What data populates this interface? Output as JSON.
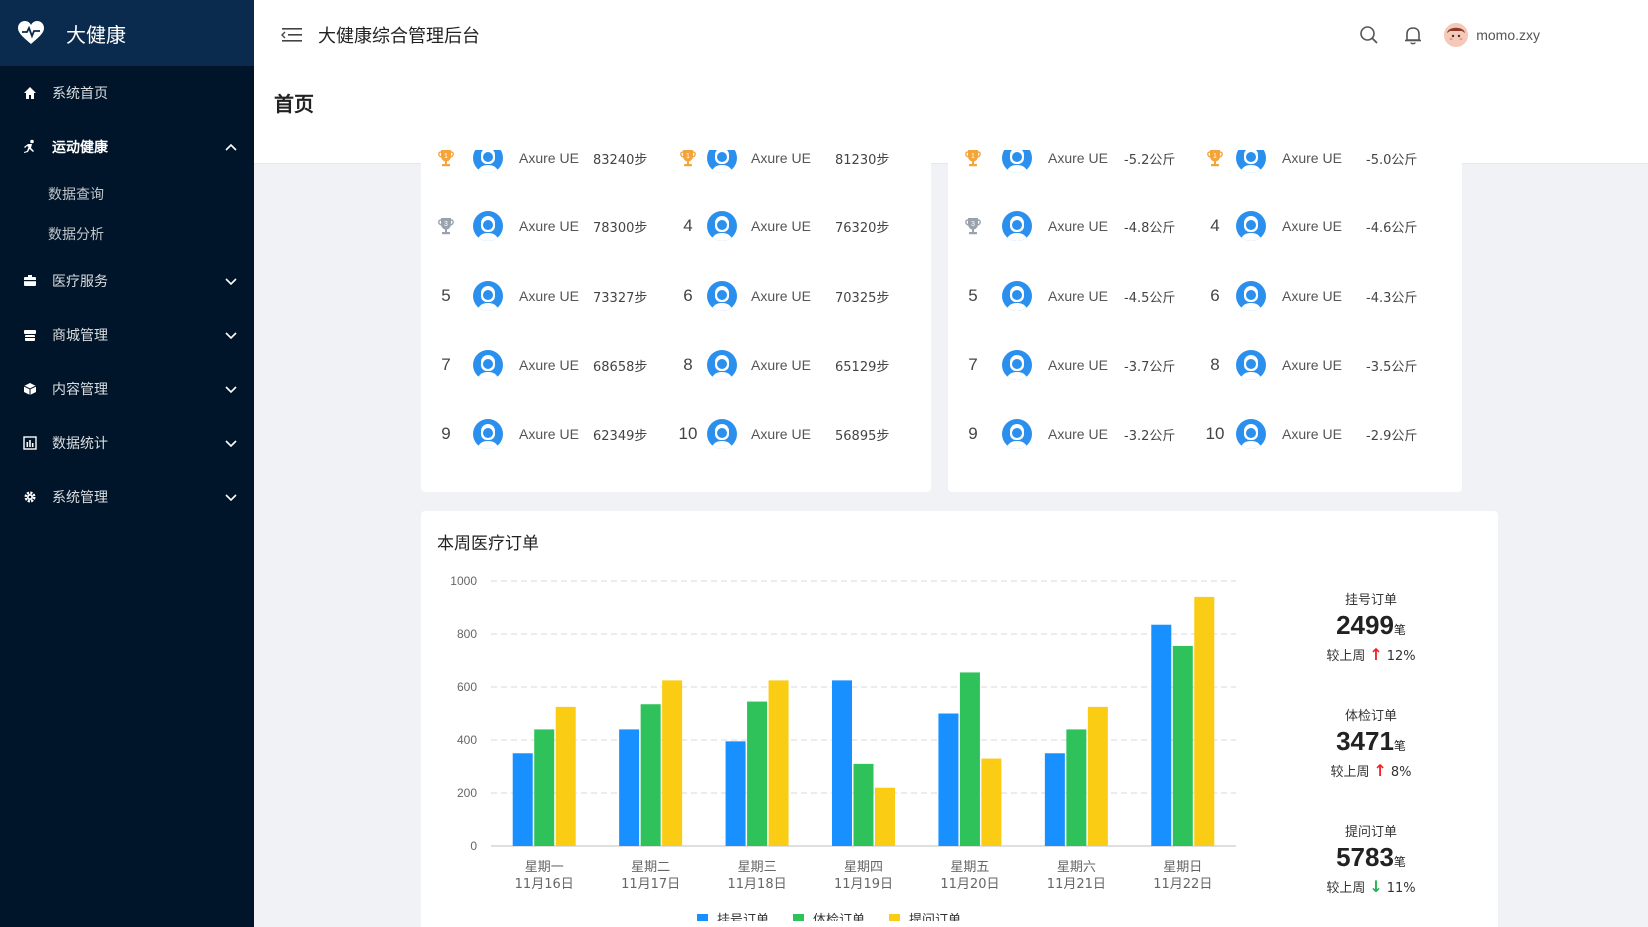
{
  "brand": {
    "name": "大健康"
  },
  "sidebar": {
    "items": [
      {
        "label": "系统首页",
        "icon": "home-icon",
        "active": false
      },
      {
        "label": "运动健康",
        "icon": "running-icon",
        "active": true,
        "expanded": true,
        "children": [
          {
            "label": "数据查询"
          },
          {
            "label": "数据分析"
          }
        ]
      },
      {
        "label": "医疗服务",
        "icon": "medical-box-icon"
      },
      {
        "label": "商城管理",
        "icon": "store-icon"
      },
      {
        "label": "内容管理",
        "icon": "cube-icon"
      },
      {
        "label": "数据统计",
        "icon": "bar-chart-icon"
      },
      {
        "label": "系统管理",
        "icon": "gear-icon"
      }
    ]
  },
  "header": {
    "title": "大健康综合管理后台",
    "username": "momo.zxy"
  },
  "page": {
    "title": "首页"
  },
  "steps_ranking": [
    [
      "",
      "Axure UE",
      "83240步",
      "",
      "Axure UE",
      "81230步"
    ],
    [
      "",
      "Axure UE",
      "78300步",
      "4",
      "Axure UE",
      "76320步"
    ],
    [
      "5",
      "Axure UE",
      "73327步",
      "6",
      "Axure UE",
      "70325步"
    ],
    [
      "7",
      "Axure UE",
      "68658步",
      "8",
      "Axure UE",
      "65129步"
    ],
    [
      "9",
      "Axure UE",
      "62349步",
      "10",
      "Axure UE",
      "56895步"
    ]
  ],
  "weight_ranking": [
    [
      "",
      "Axure UE",
      "-5.2公斤",
      "",
      "Axure UE",
      "-5.0公斤"
    ],
    [
      "",
      "Axure UE",
      "-4.8公斤",
      "4",
      "Axure UE",
      "-4.6公斤"
    ],
    [
      "5",
      "Axure UE",
      "-4.5公斤",
      "6",
      "Axure UE",
      "-4.3公斤"
    ],
    [
      "7",
      "Axure UE",
      "-3.7公斤",
      "8",
      "Axure UE",
      "-3.5公斤"
    ],
    [
      "9",
      "Axure UE",
      "-3.2公斤",
      "10",
      "Axure UE",
      "-2.9公斤"
    ]
  ],
  "orders": {
    "title": "本周医疗订单",
    "stats": [
      {
        "label": "挂号订单",
        "value": "2499",
        "unit": "笔",
        "compare": "较上周",
        "trend": "up",
        "pct": "12%"
      },
      {
        "label": "体检订单",
        "value": "3471",
        "unit": "笔",
        "compare": "较上周",
        "trend": "up",
        "pct": "8%"
      },
      {
        "label": "提问订单",
        "value": "5783",
        "unit": "笔",
        "compare": "较上周",
        "trend": "down",
        "pct": "11%"
      }
    ]
  },
  "colors": {
    "blue": "#1890ff",
    "green": "#2fc25b",
    "yellow": "#facc14",
    "sidebar": "#001529"
  },
  "chart_data": {
    "type": "bar",
    "categories": [
      "星期一\n11月16日",
      "星期二\n11月17日",
      "星期三\n11月18日",
      "星期四\n11月19日",
      "星期五\n11月20日",
      "星期六\n11月21日",
      "星期日\n11月22日"
    ],
    "category_lines": [
      [
        "星期一",
        "11月16日"
      ],
      [
        "星期二",
        "11月17日"
      ],
      [
        "星期三",
        "11月18日"
      ],
      [
        "星期四",
        "11月19日"
      ],
      [
        "星期五",
        "11月20日"
      ],
      [
        "星期六",
        "11月21日"
      ],
      [
        "星期日",
        "11月22日"
      ]
    ],
    "series": [
      {
        "name": "挂号订单",
        "color": "#1890ff",
        "values": [
          350,
          440,
          395,
          625,
          500,
          350,
          835
        ]
      },
      {
        "name": "体检订单",
        "color": "#2fc25b",
        "values": [
          440,
          535,
          545,
          310,
          655,
          440,
          755
        ]
      },
      {
        "name": "提问订单",
        "color": "#facc14",
        "values": [
          525,
          625,
          625,
          220,
          330,
          525,
          940
        ]
      }
    ],
    "ylim": [
      0,
      1000
    ],
    "yticks": [
      0,
      200,
      400,
      600,
      800,
      1000
    ],
    "grid": true,
    "legend": "bottom"
  }
}
